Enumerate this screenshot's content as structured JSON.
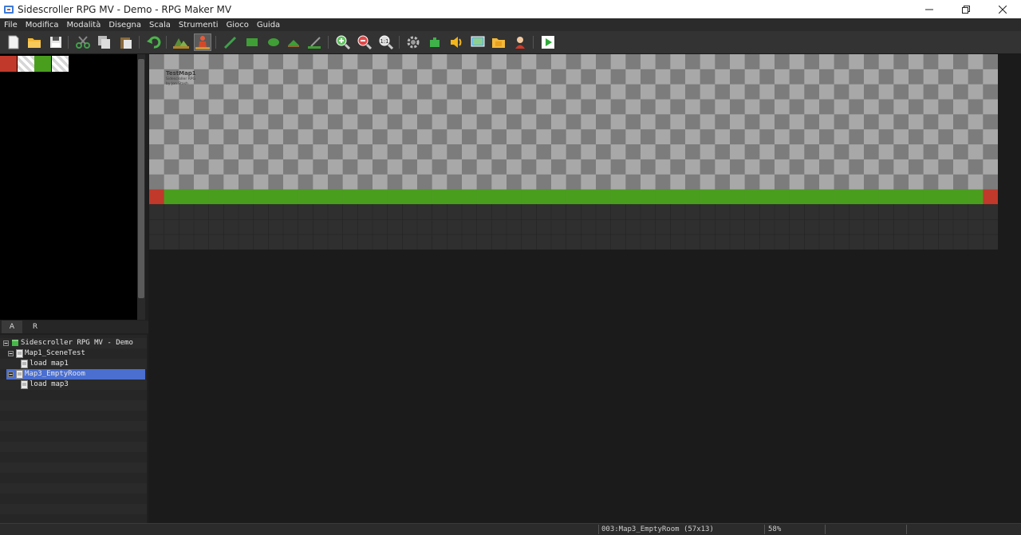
{
  "window": {
    "title": "Sidescroller RPG MV - Demo - RPG Maker MV"
  },
  "menu": [
    "File",
    "Modifica",
    "Modalità",
    "Disegna",
    "Scala",
    "Strumenti",
    "Gioco",
    "Guida"
  ],
  "toolbar": {
    "buttons": [
      {
        "name": "new-project-icon"
      },
      {
        "name": "open-project-icon"
      },
      {
        "name": "save-project-icon"
      },
      {
        "name": "cut-icon"
      },
      {
        "name": "copy-icon"
      },
      {
        "name": "paste-icon"
      },
      {
        "name": "undo-icon"
      },
      {
        "name": "map-mode-icon"
      },
      {
        "name": "event-mode-icon"
      },
      {
        "name": "pencil-icon"
      },
      {
        "name": "rectangle-icon"
      },
      {
        "name": "ellipse-icon"
      },
      {
        "name": "fill-icon"
      },
      {
        "name": "shadow-pen-icon"
      },
      {
        "name": "zoom-in-icon"
      },
      {
        "name": "zoom-out-icon"
      },
      {
        "name": "zoom-actual-icon"
      },
      {
        "name": "database-icon"
      },
      {
        "name": "plugin-manager-icon"
      },
      {
        "name": "sound-test-icon"
      },
      {
        "name": "event-searcher-icon"
      },
      {
        "name": "resource-manager-icon"
      },
      {
        "name": "character-generator-icon"
      },
      {
        "name": "playtest-icon"
      }
    ]
  },
  "tileset": {
    "tiles": [
      "#c0392b",
      "#ffffff",
      "#d8d8d8",
      "#4a9e1e",
      "#ffffff",
      "#d8d8d8"
    ]
  },
  "tabs": [
    "A",
    "R"
  ],
  "tree": {
    "items": [
      {
        "label": "Sidescroller RPG MV - Demo",
        "level": 0,
        "type": "project"
      },
      {
        "label": "Map1_SceneTest",
        "level": 1,
        "type": "map"
      },
      {
        "label": "load map1",
        "level": 2,
        "type": "map"
      },
      {
        "label": "Map3_EmptyRoom",
        "level": 1,
        "type": "map",
        "selected": true
      },
      {
        "label": "load map3",
        "level": 2,
        "type": "map"
      }
    ]
  },
  "map": {
    "name_label": "TestMap1",
    "subtitle1": "Sidescroller RPG",
    "subtitle2": "by Jon Stash",
    "columns": 57,
    "rows": 13,
    "ground_color": "#4a9e1e",
    "edge_color": "#c0392b"
  },
  "status": {
    "map_info": "003:Map3_EmptyRoom (57x13)",
    "zoom": "58%"
  }
}
